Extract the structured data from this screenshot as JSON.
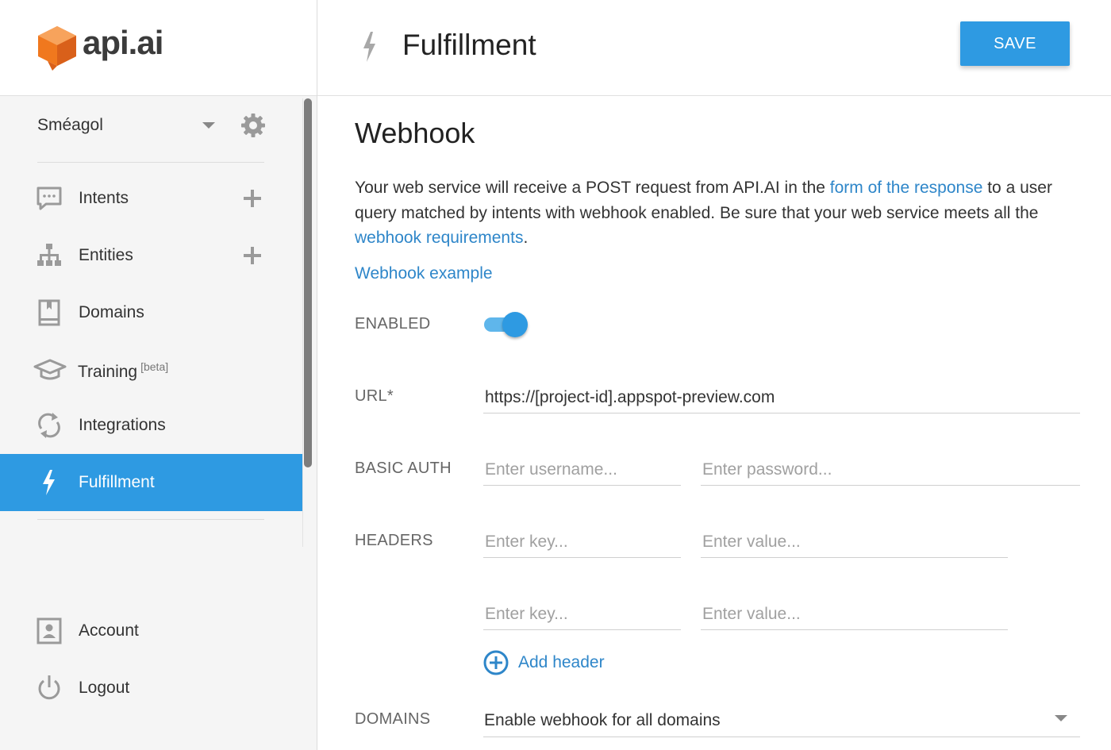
{
  "brand": {
    "name": "api.ai",
    "accent": "#2e9ae2",
    "logo_color": "#f0781e"
  },
  "sidebar": {
    "agent": {
      "name": "Sméagol",
      "dropdown_icon": "caret-down-icon",
      "settings_icon": "gear-icon"
    },
    "items": [
      {
        "label": "Intents",
        "icon": "chat-icon",
        "has_add": true
      },
      {
        "label": "Entities",
        "icon": "hierarchy-icon",
        "has_add": true
      },
      {
        "label": "Domains",
        "icon": "book-icon",
        "has_add": false
      },
      {
        "label": "Training",
        "badge": "[beta]",
        "icon": "graduation-cap-icon",
        "has_add": false
      },
      {
        "label": "Integrations",
        "icon": "sync-icon",
        "has_add": false
      },
      {
        "label": "Fulfillment",
        "icon": "lightning-icon",
        "has_add": false,
        "active": true
      }
    ],
    "footer_items": [
      {
        "label": "Account",
        "icon": "account-icon"
      },
      {
        "label": "Logout",
        "icon": "power-icon"
      }
    ]
  },
  "header": {
    "title": "Fulfillment",
    "icon": "lightning-icon",
    "save_label": "SAVE"
  },
  "main": {
    "section_title": "Webhook",
    "description": {
      "part1": "Your web service will receive a POST request from API.AI in the ",
      "link1": "form of the response",
      "part2": " to a user query matched by intents with webhook enabled. Be sure that your web service meets all the ",
      "link2": "webhook requirements",
      "part3": "."
    },
    "example_link": "Webhook example",
    "enabled": {
      "label": "ENABLED",
      "value": true
    },
    "url": {
      "label": "URL*",
      "value": "https://[project-id].appspot-preview.com"
    },
    "basic_auth": {
      "label": "BASIC AUTH",
      "username_placeholder": "Enter username...",
      "password_placeholder": "Enter password..."
    },
    "headers": {
      "label": "HEADERS",
      "rows": [
        {
          "key_placeholder": "Enter key...",
          "value_placeholder": "Enter value..."
        },
        {
          "key_placeholder": "Enter key...",
          "value_placeholder": "Enter value..."
        }
      ],
      "add_label": "Add header"
    },
    "domains": {
      "label": "DOMAINS",
      "value": "Enable webhook for all domains"
    }
  }
}
